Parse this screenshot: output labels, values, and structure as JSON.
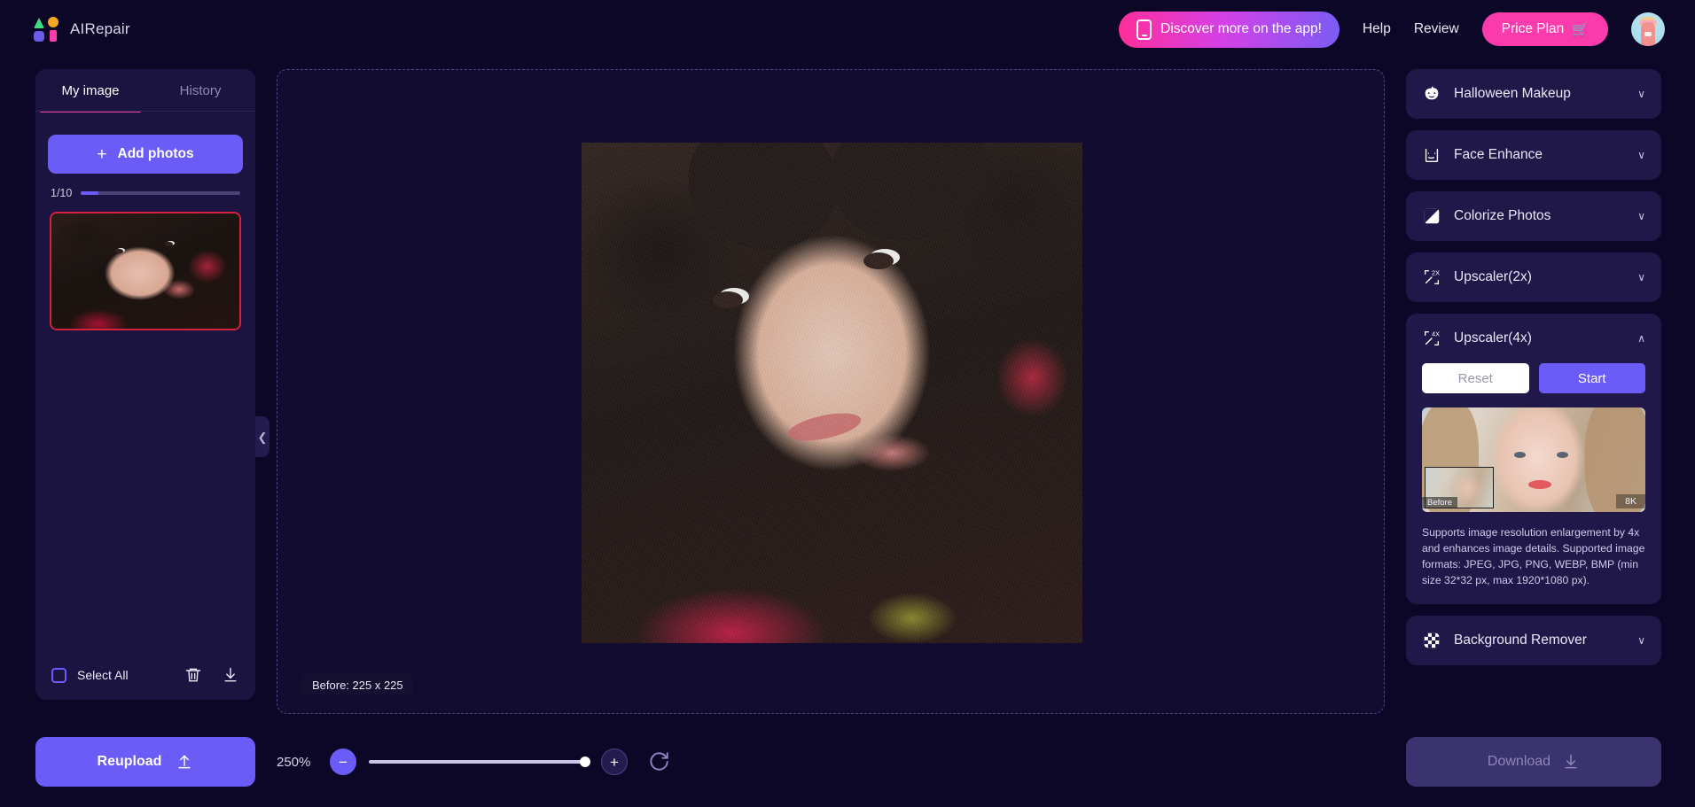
{
  "header": {
    "brand_name": "AIRepair",
    "app_promo": "Discover more on the app!",
    "help": "Help",
    "review": "Review",
    "price_plan": "Price Plan",
    "cart_glyph": "🛒"
  },
  "sidebar": {
    "tabs": [
      {
        "label": "My image",
        "active": true
      },
      {
        "label": "History",
        "active": false
      }
    ],
    "add_photos": "Add photos",
    "plus_glyph": "+",
    "count": "1/10",
    "select_all": "Select All",
    "reupload": "Reupload"
  },
  "canvas": {
    "before_badge": "Before: 225 x 225"
  },
  "zoom": {
    "percent": "250%",
    "minus": "−",
    "plus": "+"
  },
  "right_panel": {
    "items": [
      {
        "label": "Halloween Makeup",
        "icon": "pumpkin-icon",
        "expanded": false,
        "chev": "∨"
      },
      {
        "label": "Face Enhance",
        "icon": "face-enhance-icon",
        "expanded": false,
        "chev": "∨"
      },
      {
        "label": "Colorize Photos",
        "icon": "colorize-icon",
        "expanded": false,
        "chev": "∨"
      },
      {
        "label": "Upscaler(2x)",
        "icon": "upscaler-2x-icon",
        "expanded": false,
        "chev": "∨"
      },
      {
        "label": "Upscaler(4x)",
        "icon": "upscaler-4x-icon",
        "expanded": true,
        "chev": "∧"
      },
      {
        "label": "Background Remover",
        "icon": "background-remover-icon",
        "expanded": false,
        "chev": "∨"
      }
    ],
    "upscaler4x": {
      "reset": "Reset",
      "start": "Start",
      "preview_before_label": "Before",
      "preview_quality_label": "8K",
      "description": "Supports image resolution enlargement by 4x and enhances image details. Supported image formats: JPEG, JPG, PNG, WEBP, BMP (min size 32*32 px, max 1920*1080 px)."
    },
    "download": "Download"
  },
  "colors": {
    "page_bg": "#0c0726",
    "panel_bg": "#1f1849",
    "sidebar_bg": "#1b1440",
    "accent_purple": "#6c5cf7",
    "accent_pink": "#fb3bab",
    "selected_border": "#d5213c",
    "disabled_button": "#3b3270"
  }
}
